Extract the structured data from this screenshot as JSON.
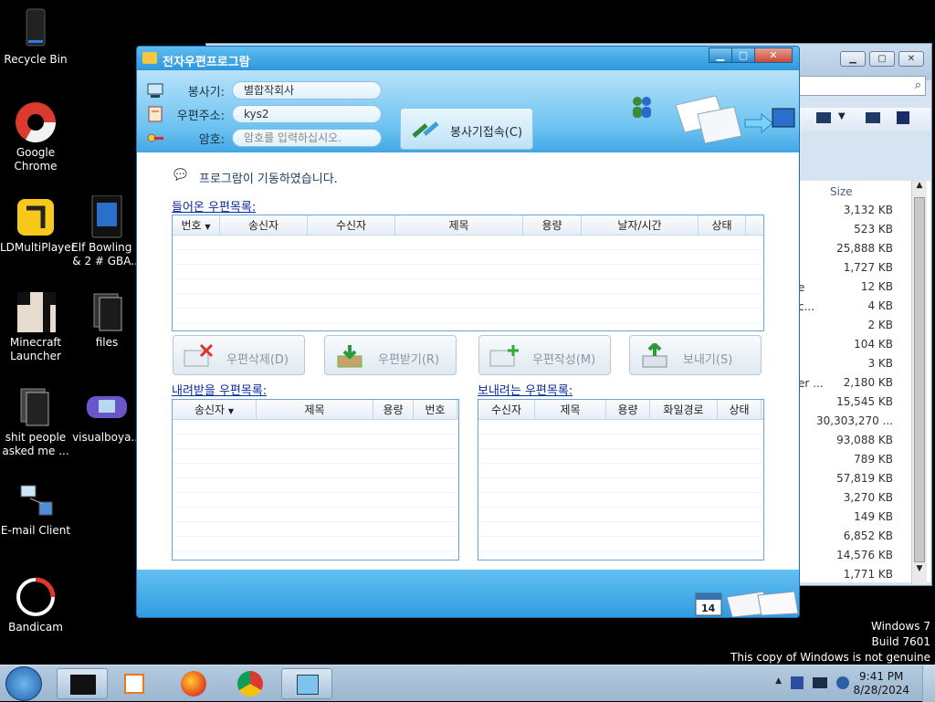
{
  "desktop": {
    "icons": [
      {
        "label": "Recycle Bin"
      },
      {
        "label": "Google Chrome"
      },
      {
        "label": "LDMultiPlayer"
      },
      {
        "label": "Elf Bowling 1 & 2 # GBA..."
      },
      {
        "label": "Minecraft Launcher"
      },
      {
        "label": "files"
      },
      {
        "label": "shit people asked me ..."
      },
      {
        "label": "visualboya..."
      },
      {
        "label": "E-mail Client"
      },
      {
        "label": "Bandicam"
      }
    ]
  },
  "explorer": {
    "size_header": "Size",
    "sizes": [
      "3,132 KB",
      "523 KB",
      "25,888 KB",
      "1,727 KB",
      "12 KB",
      "4 KB",
      "2 KB",
      "104 KB",
      "3 KB",
      "2,180 KB",
      "15,545 KB",
      "30,303,270 ...",
      "93,088 KB",
      "789 KB",
      "57,819 KB",
      "3,270 KB",
      "149 KB",
      "6,852 KB",
      "14,576 KB",
      "1,771 KB"
    ],
    "partial_names": {
      "row4": "e",
      "row5": "c...",
      "row9": "er ..."
    }
  },
  "app": {
    "title": "전자우편프로그람",
    "fields": {
      "server_label": "봉사기:",
      "server_value": "별합작회사",
      "address_label": "우편주소:",
      "address_value": "kys2",
      "password_label": "암호:",
      "password_placeholder": "암호를 입력하십시오."
    },
    "connect_label": "봉사기접속(C)",
    "status": "프로그람이 기동하였습니다.",
    "inbox": {
      "title": "들어온 우편목록:",
      "columns": [
        "번호",
        "송신자",
        "수신자",
        "제목",
        "용량",
        "날자/시간",
        "상태"
      ]
    },
    "buttons": {
      "delete": "우편삭제(D)",
      "receive": "우편받기(R)",
      "compose": "우편작성(M)",
      "send": "보내기(S)"
    },
    "download_list": {
      "title": "내려받을 우편목록:",
      "columns": [
        "송신자",
        "제목",
        "용량",
        "번호"
      ]
    },
    "send_list": {
      "title": "보내려는 우편목록:",
      "columns": [
        "수신자",
        "제목",
        "용량",
        "화일경로",
        "상태"
      ]
    },
    "calendar_day": "14"
  },
  "watermark": {
    "line1": "Windows 7",
    "line2": "Build 7601",
    "line3": "This copy of Windows is not genuine"
  },
  "taskbar": {
    "time": "9:41 PM",
    "date": "8/28/2024"
  }
}
